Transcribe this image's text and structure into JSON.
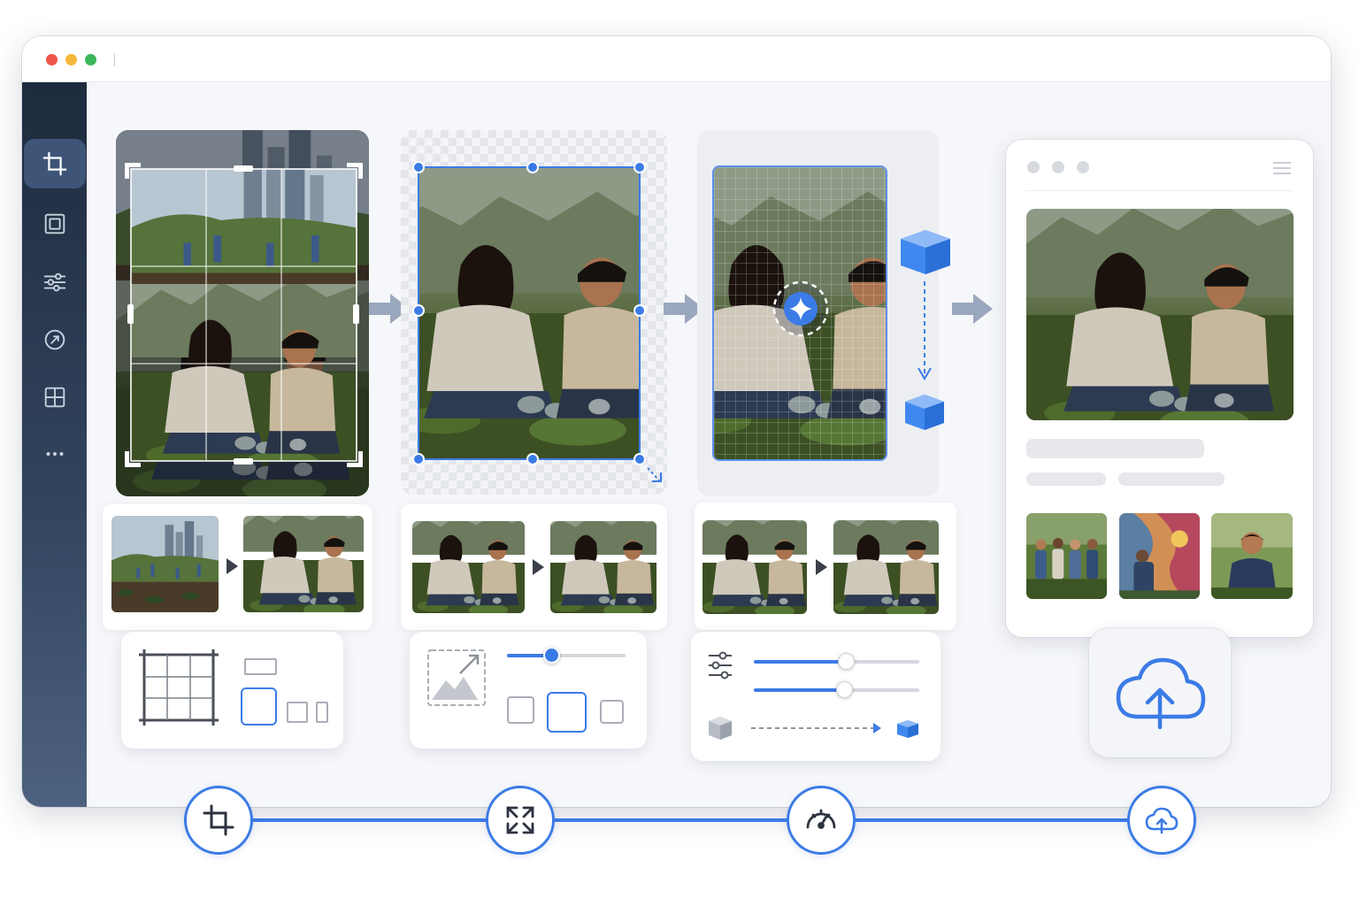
{
  "window": {
    "traffic_lights": [
      "close",
      "minimize",
      "maximize"
    ]
  },
  "sidebar": {
    "items": [
      {
        "icon": "crop-icon",
        "active": true
      },
      {
        "icon": "frame-icon",
        "active": false
      },
      {
        "icon": "sliders-icon",
        "active": false
      },
      {
        "icon": "rotate-icon",
        "active": false
      },
      {
        "icon": "grid-icon",
        "active": false
      },
      {
        "icon": "more-icon",
        "active": false
      }
    ]
  },
  "workflow": {
    "steps": [
      "crop",
      "resize",
      "optimize",
      "upload"
    ],
    "step_icons": [
      "crop-icon",
      "expand-icon",
      "gauge-icon",
      "cloud-upload-icon"
    ]
  },
  "controls": {
    "resize_slider_value": 0.38,
    "optimize_slider_1_value": 0.56,
    "optimize_slider_2_value": 0.55
  },
  "colors": {
    "accent": "#3b7be6",
    "sidebar_top": "#1e2b3e",
    "sidebar_bottom": "#4d6180",
    "traffic_red": "#f0574b",
    "traffic_yellow": "#f4b73a",
    "traffic_green": "#3cb85a"
  }
}
